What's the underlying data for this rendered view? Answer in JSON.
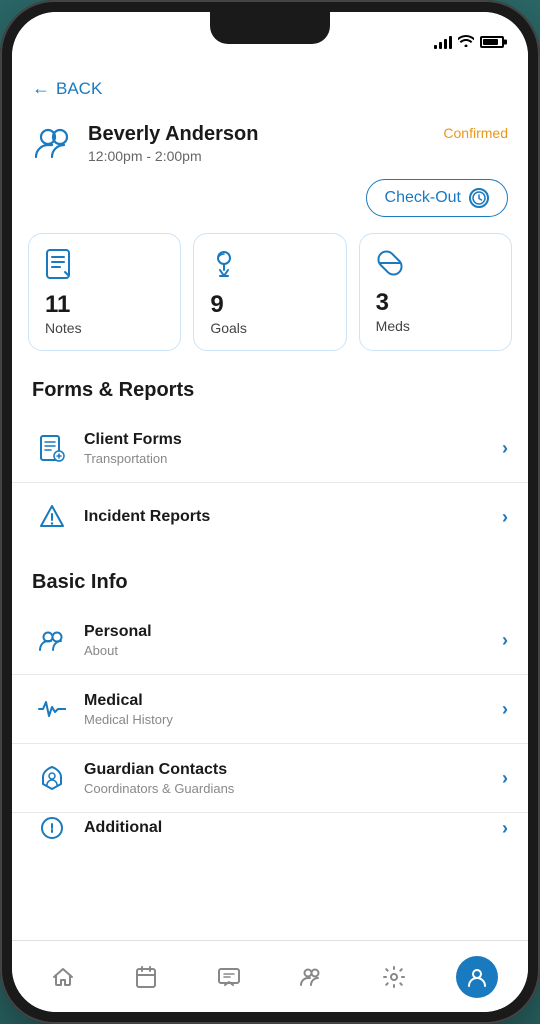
{
  "phone": {
    "notch": true
  },
  "header": {
    "back_label": "BACK"
  },
  "patient": {
    "name": "Beverly Anderson",
    "time": "12:00pm - 2:00pm",
    "status": "Confirmed"
  },
  "checkout_button": {
    "label": "Check-Out"
  },
  "stats": [
    {
      "id": "notes",
      "number": "11",
      "label": "Notes",
      "icon": "notes"
    },
    {
      "id": "goals",
      "number": "9",
      "label": "Goals",
      "icon": "goals"
    },
    {
      "id": "meds",
      "number": "3",
      "label": "Meds",
      "icon": "meds"
    }
  ],
  "sections": [
    {
      "id": "forms-reports",
      "title": "Forms & Reports",
      "items": [
        {
          "id": "client-forms",
          "title": "Client Forms",
          "subtitle": "Transportation",
          "icon": "client-forms"
        },
        {
          "id": "incident-reports",
          "title": "Incident Reports",
          "subtitle": "",
          "icon": "incident-reports"
        }
      ]
    },
    {
      "id": "basic-info",
      "title": "Basic Info",
      "items": [
        {
          "id": "personal",
          "title": "Personal",
          "subtitle": "About",
          "icon": "personal"
        },
        {
          "id": "medical",
          "title": "Medical",
          "subtitle": "Medical History",
          "icon": "medical"
        },
        {
          "id": "guardian-contacts",
          "title": "Guardian Contacts",
          "subtitle": "Coordinators & Guardians",
          "icon": "guardian"
        },
        {
          "id": "additional",
          "title": "Additional",
          "subtitle": "",
          "icon": "additional"
        }
      ]
    }
  ],
  "bottom_nav": [
    {
      "id": "home",
      "icon": "home",
      "label": ""
    },
    {
      "id": "calendar",
      "icon": "calendar",
      "label": ""
    },
    {
      "id": "messages",
      "icon": "messages",
      "label": ""
    },
    {
      "id": "users",
      "icon": "users",
      "label": ""
    },
    {
      "id": "settings",
      "icon": "settings",
      "label": ""
    },
    {
      "id": "profile",
      "icon": "profile-active",
      "label": "",
      "active": true
    }
  ]
}
